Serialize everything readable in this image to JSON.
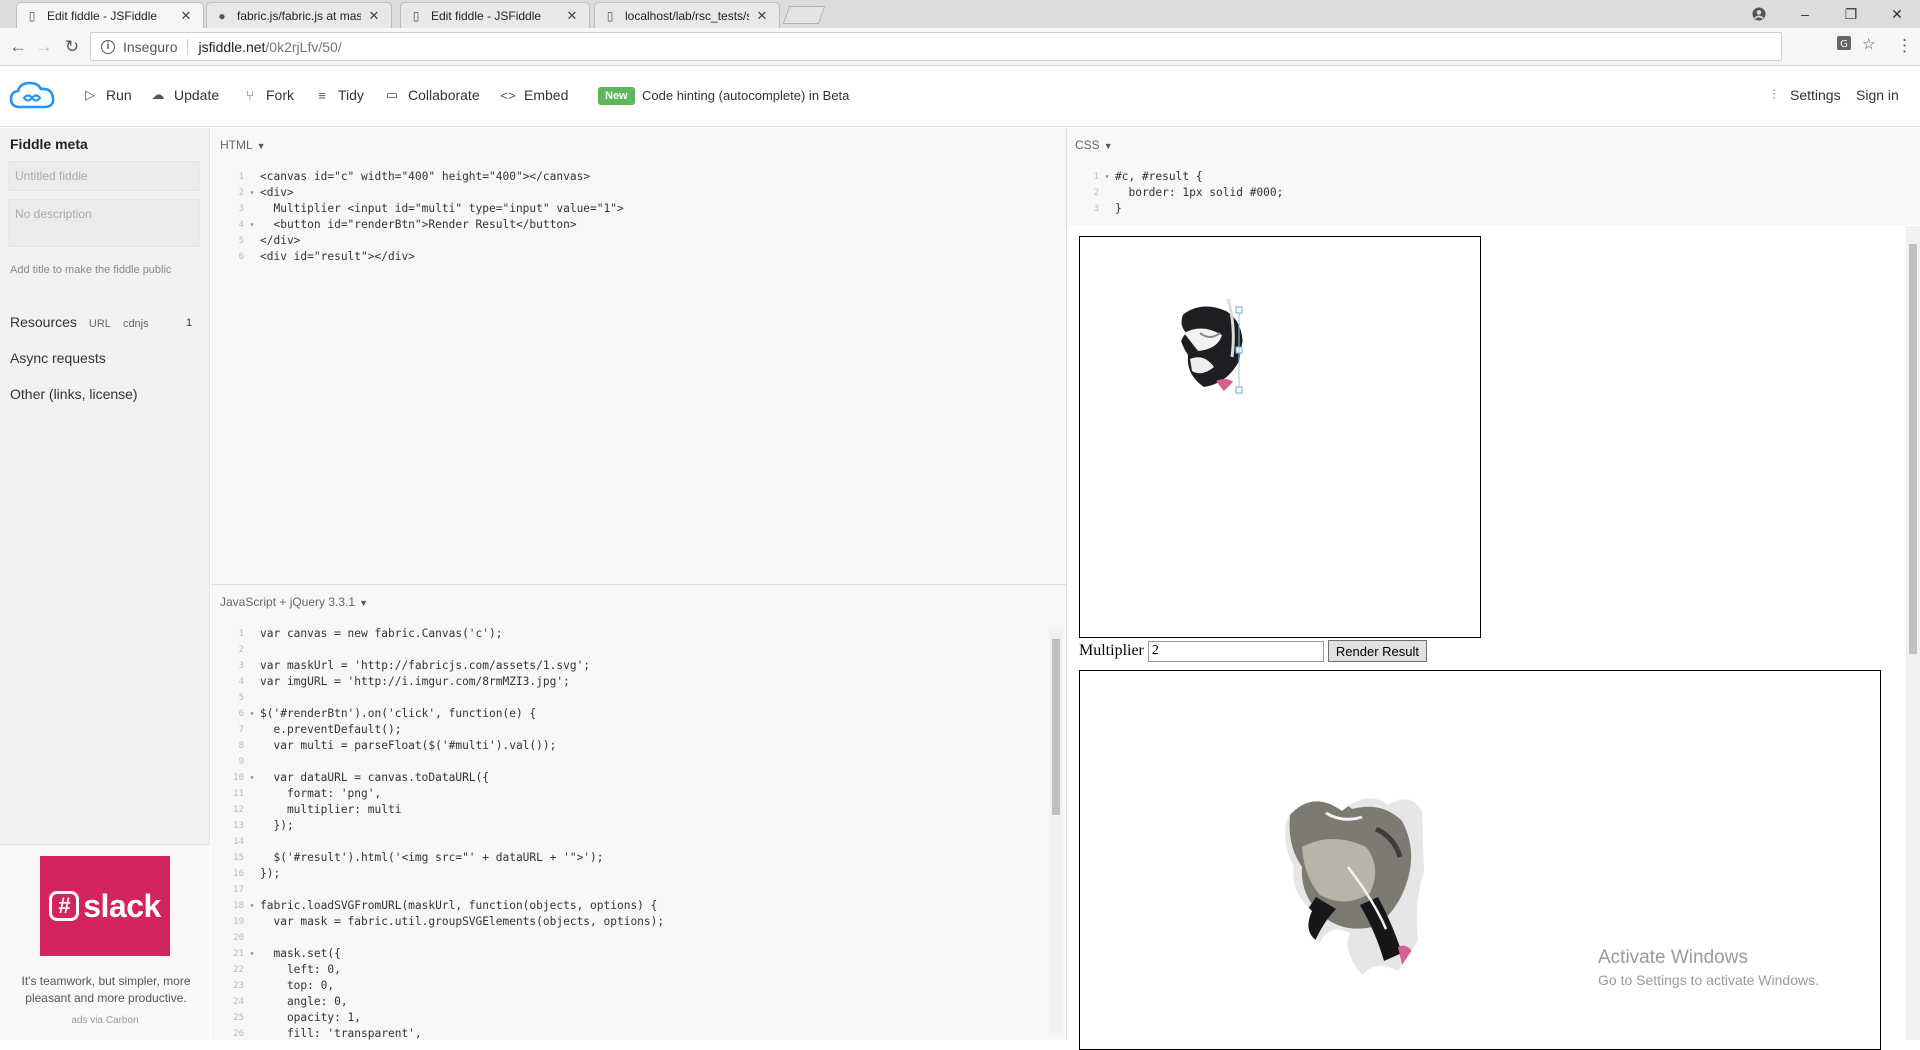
{
  "browser": {
    "tabs": [
      {
        "title": "Edit fiddle - JSFiddle",
        "icon": "page-icon",
        "active": true
      },
      {
        "title": "fabric.js/fabric.js at maste",
        "icon": "github-icon",
        "active": false
      },
      {
        "title": "Edit fiddle - JSFiddle",
        "icon": "page-icon",
        "active": false
      },
      {
        "title": "localhost/lab/rsc_tests/sh",
        "icon": "page-icon",
        "active": false
      }
    ],
    "security_label": "Inseguro",
    "url_host": "jsfiddle.net",
    "url_path": "/0k2rjLfv/50/"
  },
  "toolbar": {
    "run": "Run",
    "update": "Update",
    "fork": "Fork",
    "tidy": "Tidy",
    "collaborate": "Collaborate",
    "embed": "Embed",
    "badge": "New",
    "hint": "Code hinting (autocomplete) in Beta",
    "settings": "Settings",
    "signin": "Sign in"
  },
  "sidebar": {
    "title": "Fiddle meta",
    "title_placeholder": "Untitled fiddle",
    "desc_placeholder": "No description",
    "hint": "Add title to make the fiddle public",
    "resources": "Resources",
    "resources_url": "URL",
    "resources_cdnjs": "cdnjs",
    "resources_count": "1",
    "async": "Async requests",
    "other": "Other (links, license)",
    "ad_brand": "slack",
    "ad_copy": "It's teamwork, but simpler, more pleasant and more productive.",
    "ad_via": "ads via Carbon"
  },
  "panels": {
    "html_label": "HTML",
    "css_label": "CSS",
    "js_label": "JavaScript + jQuery 3.3.1"
  },
  "html_code": [
    "<canvas id=\"c\" width=\"400\" height=\"400\"></canvas>",
    "<div>",
    "  Multiplier <input id=\"multi\" type=\"input\" value=\"1\">",
    "  <button id=\"renderBtn\">Render Result</button>",
    "</div>",
    "<div id=\"result\"></div>"
  ],
  "css_code": [
    "#c, #result {",
    "  border: 1px solid #000;",
    "}"
  ],
  "js_code": [
    "var canvas = new fabric.Canvas('c');",
    "",
    "var maskUrl = 'http://fabricjs.com/assets/1.svg';",
    "var imgURL = 'http://i.imgur.com/8rmMZI3.jpg';",
    "",
    "$('#renderBtn').on('click', function(e) {",
    "  e.preventDefault();",
    "  var multi = parseFloat($('#multi').val());",
    "",
    "  var dataURL = canvas.toDataURL({",
    "    format: 'png',",
    "    multiplier: multi",
    "  });",
    "",
    "  $('#result').html('<img src=\"' + dataURL + '\">');",
    "});",
    "",
    "fabric.loadSVGFromURL(maskUrl, function(objects, options) {",
    "  var mask = fabric.util.groupSVGElements(objects, options);",
    "",
    "  mask.set({",
    "    left: 0,",
    "    top: 0,",
    "    angle: 0,",
    "    opacity: 1,",
    "    fill: 'transparent',"
  ],
  "result": {
    "multiplier_label": "Multiplier",
    "multiplier_value": "2",
    "render_button": "Render Result"
  },
  "watermark": {
    "line1": "Activate Windows",
    "line2": "Go to Settings to activate Windows."
  }
}
